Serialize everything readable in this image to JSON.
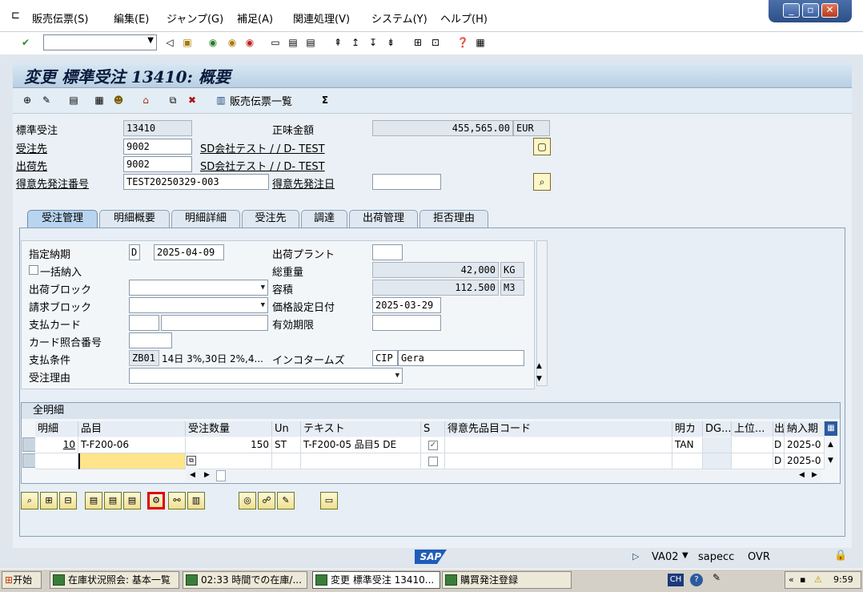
{
  "menu": {
    "items": [
      "販売伝票(S)",
      "編集(E)",
      "ジャンプ(G)",
      "補足(A)",
      "関連処理(V)",
      "システム(Y)",
      "ヘルプ(H)"
    ]
  },
  "window": {
    "min": "_",
    "restore": "▫",
    "close": "✕"
  },
  "header": {
    "title": "変更 標準受注 13410: 概要",
    "doc_flow_button": "販売伝票一覧"
  },
  "form": {
    "order_type_label": "標準受注",
    "order_no": "13410",
    "net_value_label": "正味金額",
    "net_value": "455,565.00",
    "currency": "EUR",
    "sold_to_label": "受注先",
    "sold_to": "9002",
    "sold_to_name": "SD会社テスト / / D- TEST",
    "ship_to_label": "出荷先",
    "ship_to": "9002",
    "ship_to_name": "SD会社テスト / / D- TEST",
    "po_no_label": "得意先発注番号",
    "po_no": "TEST20250329-003",
    "po_date_label": "得意先発注日",
    "po_date": ""
  },
  "tabs": [
    "受注管理",
    "明細概要",
    "明細詳細",
    "受注先",
    "調達",
    "出荷管理",
    "拒否理由"
  ],
  "sales": {
    "delivery_date_label": "指定納期",
    "delivery_date_type": "D",
    "delivery_date": "2025-04-09",
    "complete_delivery_label": "一括納入",
    "delivery_block_label": "出荷ブロック",
    "billing_block_label": "請求ブロック",
    "payment_card_label": "支払カード",
    "card_verification_label": "カード照合番号",
    "payment_terms_label": "支払条件",
    "payment_terms": "ZB01",
    "payment_terms_text": "14日 3%,30日 2%,4...",
    "order_reason_label": "受注理由",
    "plant_label": "出荷プラント",
    "plant": "",
    "total_weight_label": "総重量",
    "total_weight": "42,000",
    "weight_unit": "KG",
    "volume_label": "容積",
    "volume": "112.500",
    "volume_unit": "M3",
    "pricing_date_label": "価格設定日付",
    "pricing_date": "2025-03-29",
    "valid_to_label": "有効期限",
    "valid_to": "",
    "incoterms_label": "インコタームズ",
    "incoterms": "CIP",
    "incoterms_place": "Gera"
  },
  "items_table": {
    "caption": "全明細",
    "headers": [
      "明細",
      "品目",
      "受注数量",
      "Un",
      "テキスト",
      "S",
      "得意先品目コード",
      "明カ",
      "DG...",
      "上位...",
      "出",
      "納入期"
    ],
    "rows": [
      {
        "item": "10",
        "material": "T-F200-06",
        "qty": "150",
        "unit": "ST",
        "text": "T-F200-05  品目5 DE",
        "s": "✓",
        "cust_mat": "",
        "cat": "TAN",
        "dg": "",
        "higher": "",
        "sched": "D",
        "date": "2025-0"
      },
      {
        "item": "",
        "material": "",
        "qty": "",
        "unit": "",
        "text": "",
        "s": "",
        "cust_mat": "",
        "cat": "",
        "dg": "",
        "higher": "",
        "sched": "D",
        "date": "2025-0"
      }
    ]
  },
  "status": {
    "transaction": "VA02",
    "system": "sapecc",
    "mode": "OVR"
  },
  "taskbar": {
    "start": "开始",
    "tasks": [
      "在庫状況照会: 基本一覧",
      "02:33 時間での在庫/...",
      "変更 標準受注 13410...",
      "購買発注登録"
    ],
    "lang": "CH",
    "time": "9:59"
  }
}
